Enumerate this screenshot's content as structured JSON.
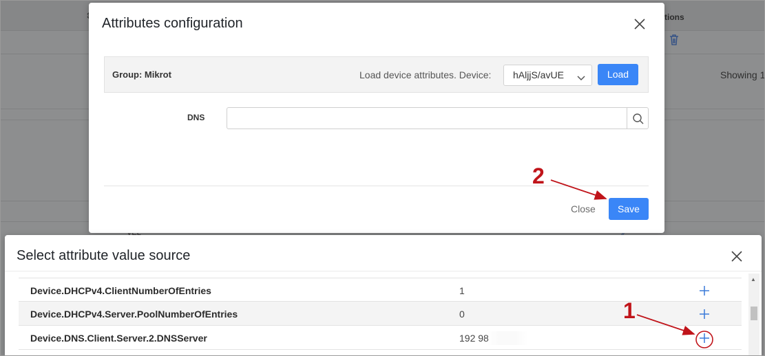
{
  "background": {
    "column_header_actions": "tions",
    "showing_text": "Showing 1",
    "row_fragment": "VEL"
  },
  "attributes_modal": {
    "title": "Attributes configuration",
    "group_label": "Group: Mikrot",
    "load_text": "Load device attributes. Device:",
    "device_selected": "hAljjS/avUE",
    "load_button": "Load",
    "dns_label": "DNS",
    "dns_value": "",
    "close_label": "Close",
    "save_label": "Save"
  },
  "source_modal": {
    "title": "Select attribute value source",
    "rows": [
      {
        "name": "Device.DHCPv4.ClientNumberOfEntries",
        "value": "1"
      },
      {
        "name": "Device.DHCPv4.Server.PoolNumberOfEntries",
        "value": "0"
      },
      {
        "name": "Device.DNS.Client.Server.2.DNSServer",
        "value": "192          98"
      }
    ]
  },
  "annotations": {
    "step1": "1",
    "step2": "2",
    "color": "#c0141a"
  },
  "colors": {
    "primary": "#3a86f7",
    "overlay": "#8d8e8f"
  }
}
